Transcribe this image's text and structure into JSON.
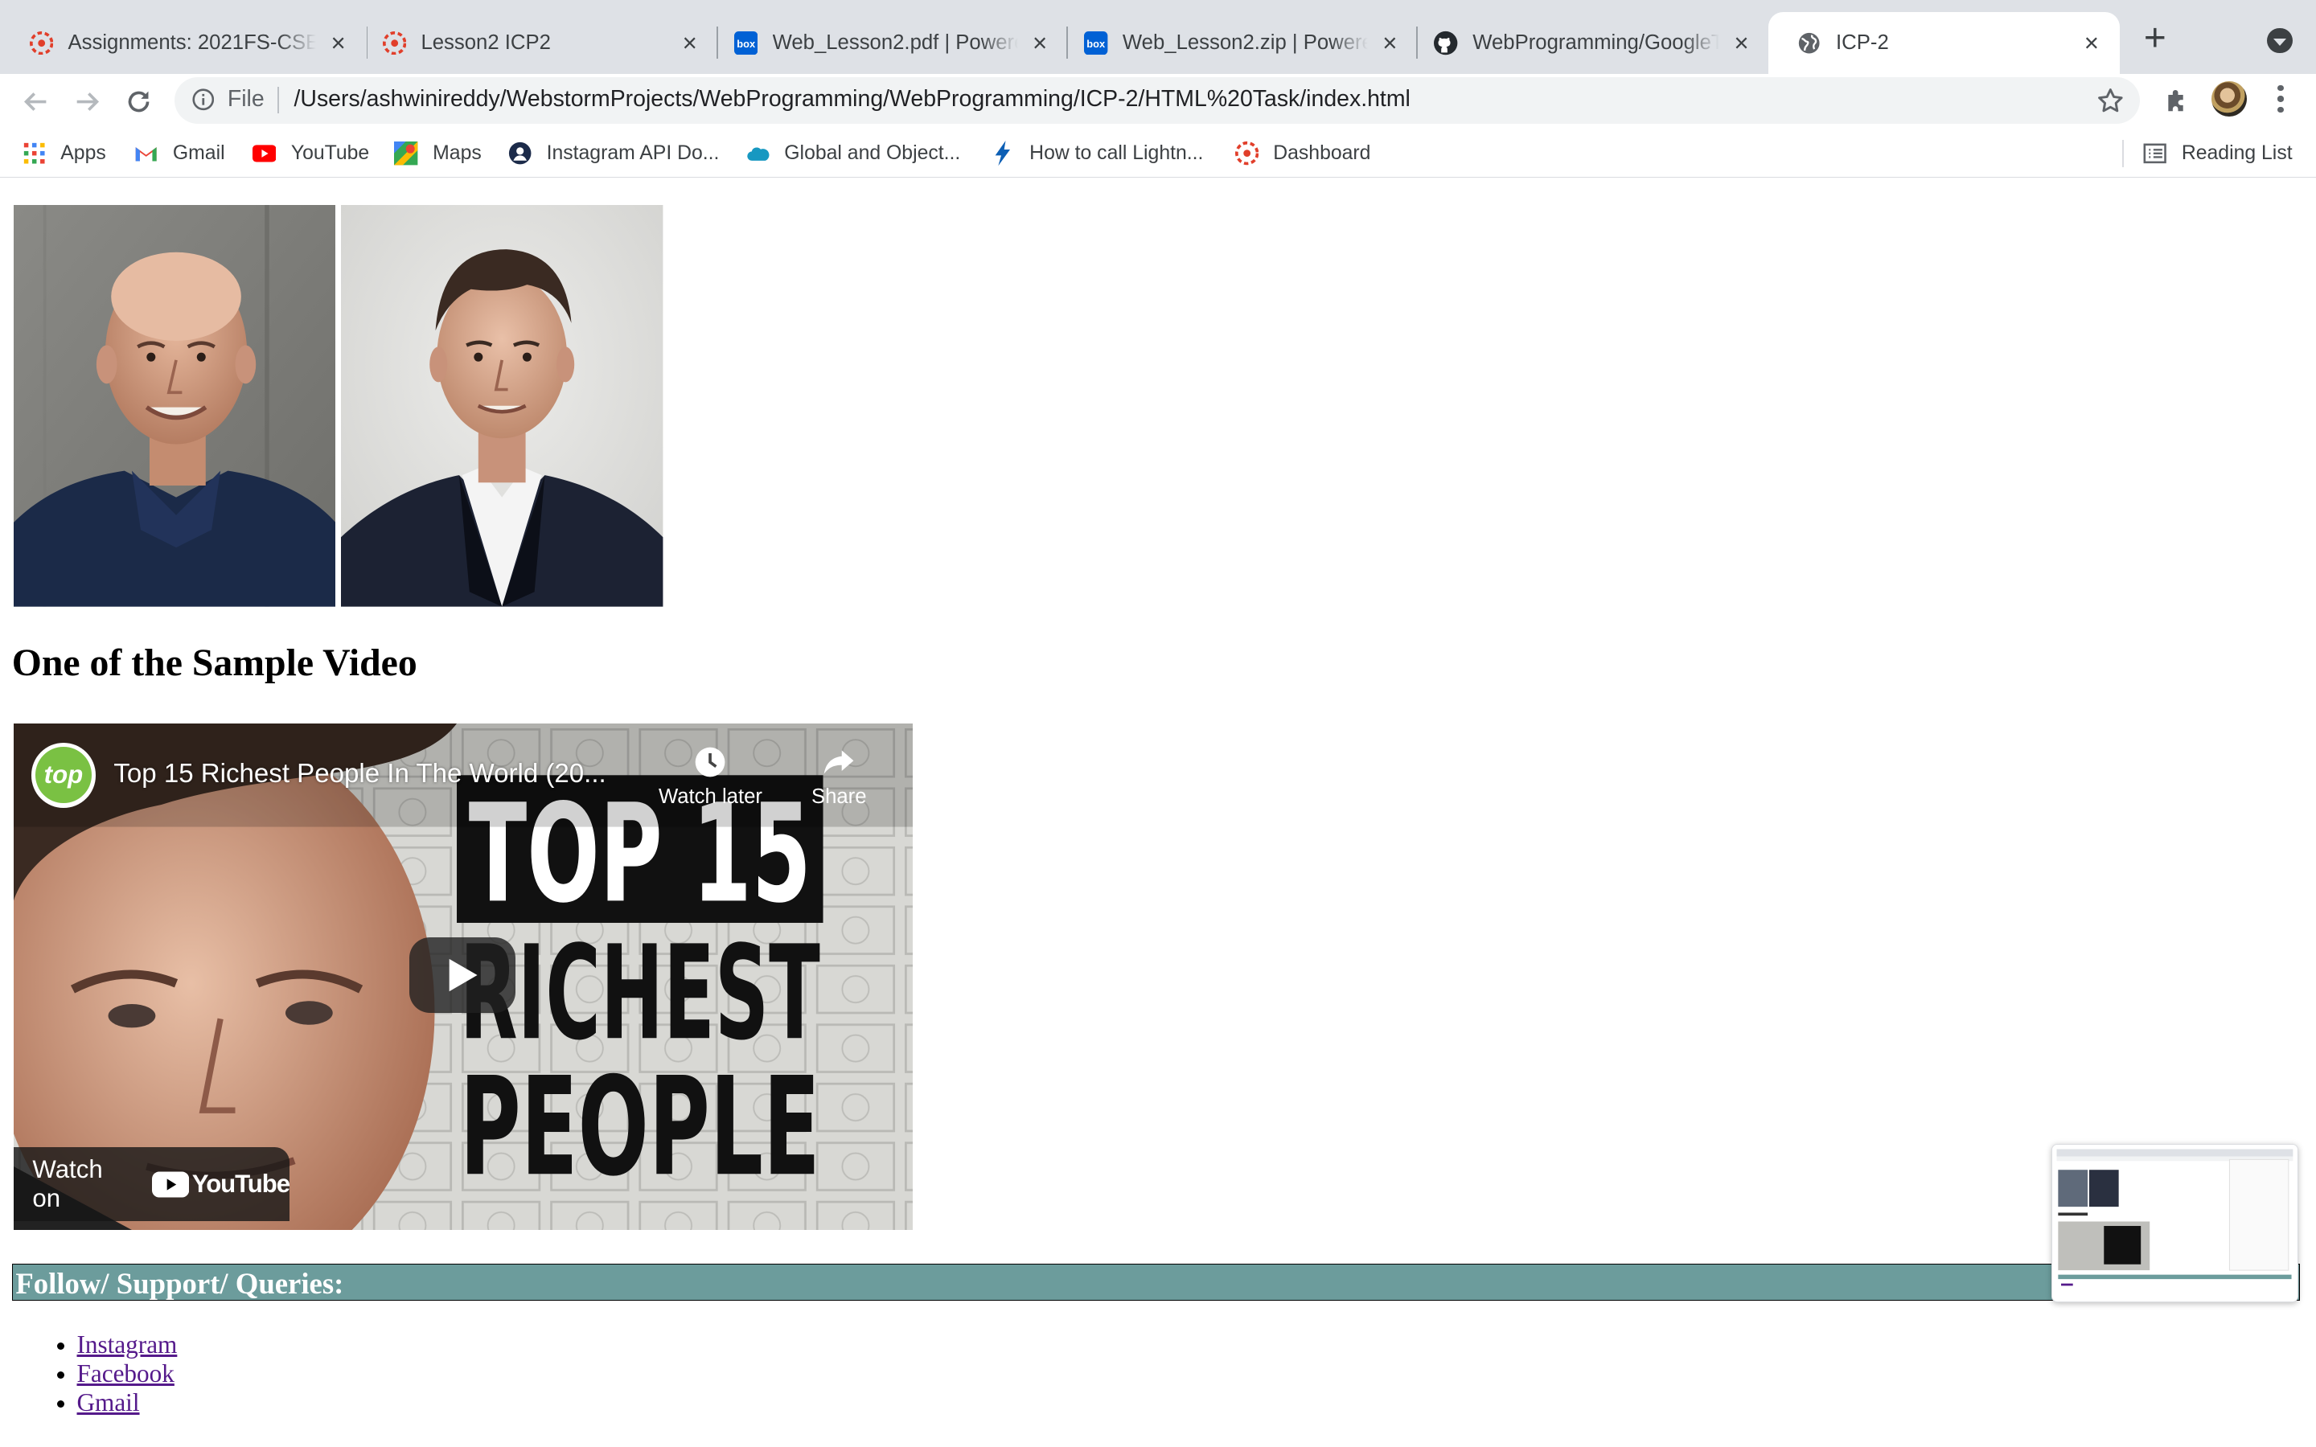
{
  "tabs": [
    {
      "title": "Assignments: 2021FS-CSE",
      "favicon": "canvas-icon",
      "active": false
    },
    {
      "title": "Lesson2 ICP2",
      "favicon": "canvas-icon",
      "active": false
    },
    {
      "title": "Web_Lesson2.pdf | Powere",
      "favicon": "box-icon",
      "active": false
    },
    {
      "title": "Web_Lesson2.zip | Powere",
      "favicon": "box-icon",
      "active": false
    },
    {
      "title": "WebProgramming/GoogleTa",
      "favicon": "github-icon",
      "active": false
    },
    {
      "title": "ICP-2",
      "favicon": "globe-icon",
      "active": true
    }
  ],
  "box_label": "box",
  "omnibox": {
    "scheme": "File",
    "url": "/Users/ashwinireddy/WebstormProjects/WebProgramming/WebProgramming/ICP-2/HTML%20Task/index.html"
  },
  "bookmarks": [
    {
      "label": "Apps",
      "icon": "apps-grid-icon"
    },
    {
      "label": "Gmail",
      "icon": "gmail-icon"
    },
    {
      "label": "YouTube",
      "icon": "youtube-icon"
    },
    {
      "label": "Maps",
      "icon": "maps-icon"
    },
    {
      "label": "Instagram API Do...",
      "icon": "instagram-api-icon"
    },
    {
      "label": "Global and Object...",
      "icon": "salesforce-cloud-icon"
    },
    {
      "label": "How to call Lightn...",
      "icon": "lightning-icon"
    },
    {
      "label": "Dashboard",
      "icon": "canvas-icon"
    }
  ],
  "reading_list": "Reading List",
  "page": {
    "heading": "One of the Sample Video",
    "video": {
      "channel_badge": "top",
      "title": "Top 15 Richest People In The World (20...",
      "watch_later": "Watch later",
      "share": "Share",
      "thumb_line1": "TOP 15",
      "thumb_line2": "RICHEST",
      "thumb_line3": "PEOPLE",
      "watch_on": "Watch on",
      "youtube_wordmark": "YouTube"
    },
    "follow_heading": "Follow/ Support/ Queries:",
    "links": [
      "Instagram",
      "Facebook",
      "Gmail"
    ]
  },
  "colors": {
    "tabstrip": "#dee1e6",
    "follow_bar": "#6c9c9c",
    "visited_link": "#551a8b",
    "youtube_red": "#ff0000"
  }
}
